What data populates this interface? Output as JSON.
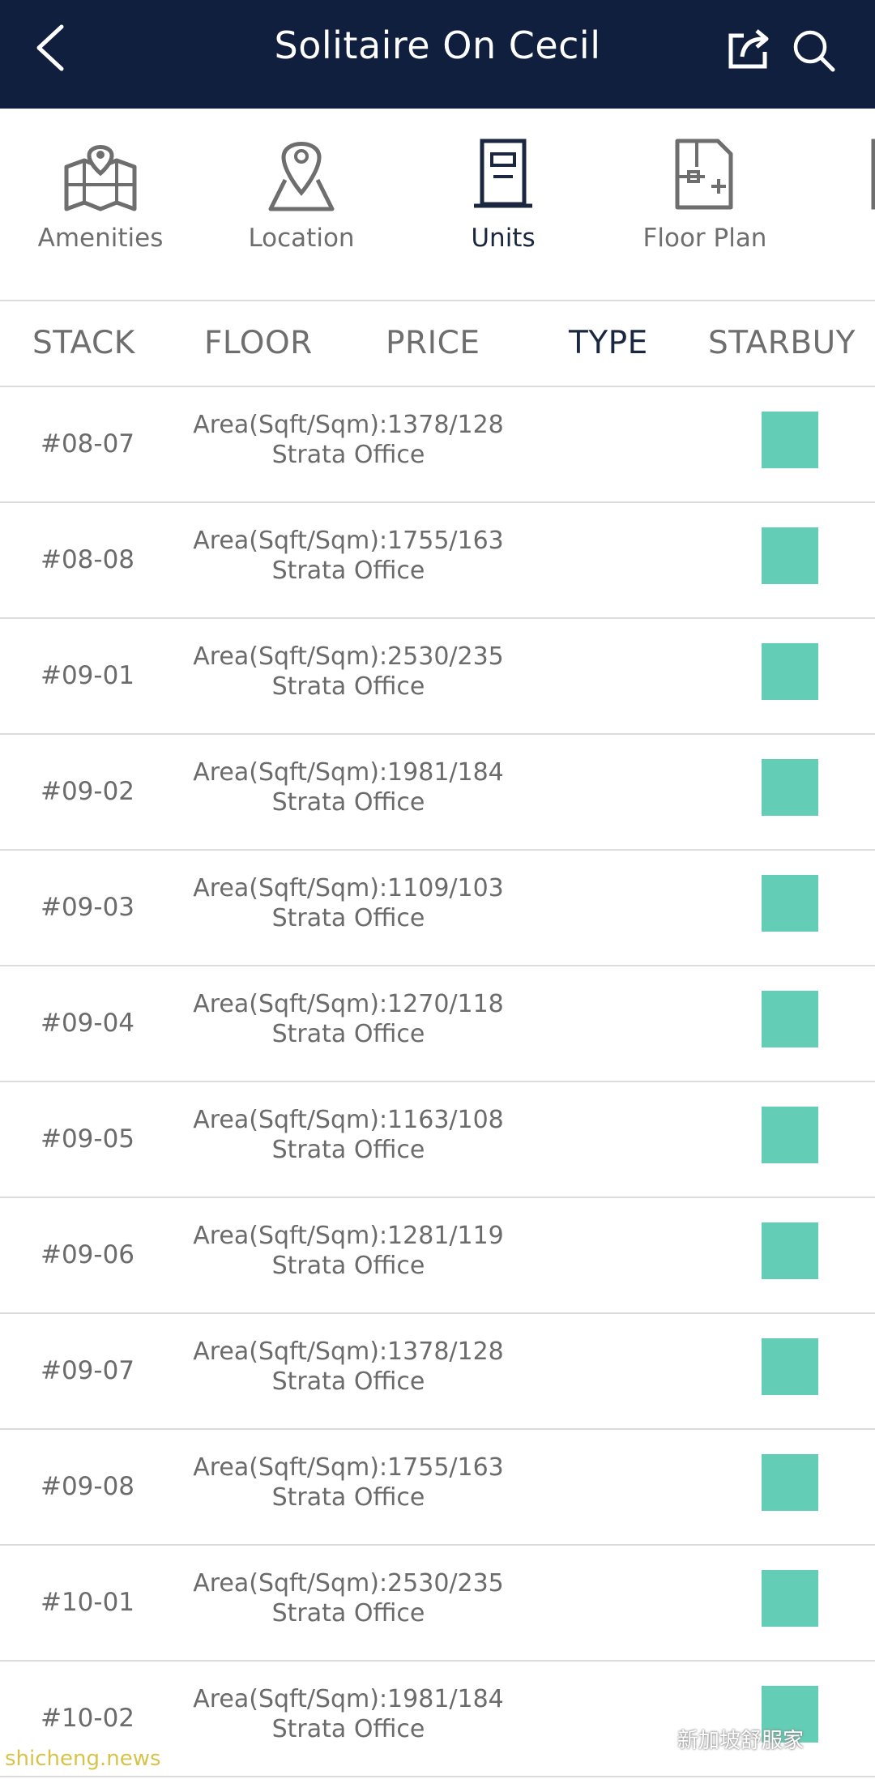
{
  "header": {
    "title": "Solitaire On Cecil",
    "back_icon": "chevron-left-icon",
    "share_icon": "share-icon",
    "search_icon": "search-icon"
  },
  "categories": [
    {
      "label": "Amenities",
      "icon": "map-pin-icon",
      "active": false
    },
    {
      "label": "Location",
      "icon": "location-pin-icon",
      "active": false
    },
    {
      "label": "Units",
      "icon": "door-icon",
      "active": true
    },
    {
      "label": "Floor Plan",
      "icon": "floor-plan-icon",
      "active": false
    }
  ],
  "columns": {
    "stack": "STACK",
    "floor": "FLOOR",
    "price": "PRICE",
    "type": "TYPE",
    "starbuy": "STARBUY"
  },
  "rows": [
    {
      "stack": "#08-07",
      "area": "Area(Sqft/Sqm):1378/128",
      "type": "Strata Office"
    },
    {
      "stack": "#08-08",
      "area": "Area(Sqft/Sqm):1755/163",
      "type": "Strata Office"
    },
    {
      "stack": "#09-01",
      "area": "Area(Sqft/Sqm):2530/235",
      "type": "Strata Office"
    },
    {
      "stack": "#09-02",
      "area": "Area(Sqft/Sqm):1981/184",
      "type": "Strata Office"
    },
    {
      "stack": "#09-03",
      "area": "Area(Sqft/Sqm):1109/103",
      "type": "Strata Office"
    },
    {
      "stack": "#09-04",
      "area": "Area(Sqft/Sqm):1270/118",
      "type": "Strata Office"
    },
    {
      "stack": "#09-05",
      "area": "Area(Sqft/Sqm):1163/108",
      "type": "Strata Office"
    },
    {
      "stack": "#09-06",
      "area": "Area(Sqft/Sqm):1281/119",
      "type": "Strata Office"
    },
    {
      "stack": "#09-07",
      "area": "Area(Sqft/Sqm):1378/128",
      "type": "Strata Office"
    },
    {
      "stack": "#09-08",
      "area": "Area(Sqft/Sqm):1755/163",
      "type": "Strata Office"
    },
    {
      "stack": "#10-01",
      "area": "Area(Sqft/Sqm):2530/235",
      "type": "Strata Office"
    },
    {
      "stack": "#10-02",
      "area": "Area(Sqft/Sqm):1981/184",
      "type": "Strata Office"
    }
  ],
  "colors": {
    "header_bg": "#0f1f3d",
    "starbuy_badge": "#64cdb5"
  },
  "watermarks": {
    "left": "shicheng.news",
    "right": "新加坡舒服家"
  }
}
